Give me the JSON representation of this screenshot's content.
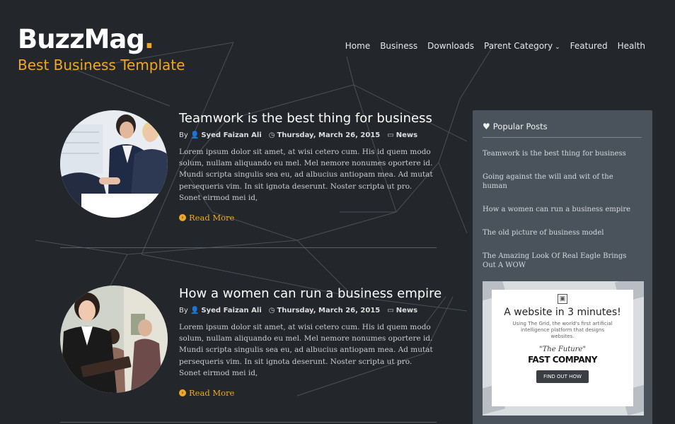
{
  "brand": {
    "name": "BuzzMag",
    "dot": ".",
    "tagline": "Best Business Template"
  },
  "nav": [
    {
      "label": "Home"
    },
    {
      "label": "Business"
    },
    {
      "label": "Downloads"
    },
    {
      "label": "Parent Category"
    },
    {
      "label": "Featured"
    },
    {
      "label": "Health"
    }
  ],
  "posts": [
    {
      "title": "Teamwork is the best thing for business",
      "by": "By",
      "author": "Syed Faizan Ali",
      "date": "Thursday, March 26, 2015",
      "category": "News",
      "excerpt": "Lorem ipsum dolor sit amet, at wisi cetero cum. His id quem modo solum, nullam aliquando eu mel. Mel nemore nonumes oportere id. Mundi scripta singulis sea eu, ad albucius antiopam mea. Ad mutat persequeris vim. In sit ignota deserunt. Noster scripta ut pro. Sonet eirmod mei id,",
      "read_more": "Read More"
    },
    {
      "title": "How a women can run a business empire",
      "by": "By",
      "author": "Syed Faizan Ali",
      "date": "Thursday, March 26, 2015",
      "category": "News",
      "excerpt": "Lorem ipsum dolor sit amet, at wisi cetero cum. His id quem modo solum, nullam aliquando eu mel. Mel nemore nonumes oportere id. Mundi scripta singulis sea eu, ad albucius antiopam mea. Ad mutat persequeris vim. In sit ignota deserunt. Noster scripta ut pro. Sonet eirmod mei id,",
      "read_more": "Read More"
    }
  ],
  "sidebar": {
    "popular_title": "Popular Posts",
    "popular": [
      "Teamwork is the best thing for business",
      "Going against the will and wit of the human",
      "How a women can run a business empire",
      "The old picture of business model",
      "The Amazing Look Of Real Eagle Brings Out A WOW"
    ],
    "ad": {
      "headline": "A website in 3 minutes!",
      "sub": "Using The Grid, the world's first artificial intelligence platform that designs websites.",
      "quote": "\"The Future\"",
      "brand": "FAST COMPANY",
      "cta": "FIND OUT HOW"
    }
  },
  "colors": {
    "accent": "#f0a725",
    "background": "#23272c",
    "sidebar": "#4a535c"
  }
}
